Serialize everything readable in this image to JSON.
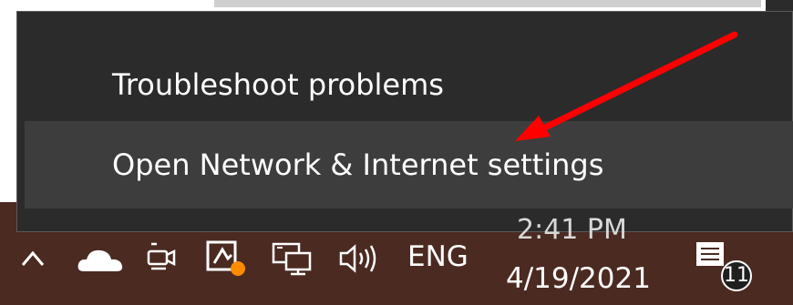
{
  "context_menu": {
    "items": [
      {
        "label": "Troubleshoot problems"
      },
      {
        "label": "Open Network & Internet settings"
      }
    ]
  },
  "taskbar": {
    "language": "ENG",
    "time": "2:41 PM",
    "date": "4/19/2021",
    "notifications_count": "11",
    "icons": [
      "chevron-up-icon",
      "onedrive-cloud-icon",
      "camera-icon",
      "security-icon",
      "network-icon",
      "volume-icon",
      "notification-icon"
    ]
  },
  "colors": {
    "menu_bg": "#2b2b2b",
    "menu_hover_bg": "#3d3d3d",
    "taskbar_bg": "#4b2a22",
    "arrow": "#ff0000",
    "badge_dot": "#ff8c00"
  }
}
